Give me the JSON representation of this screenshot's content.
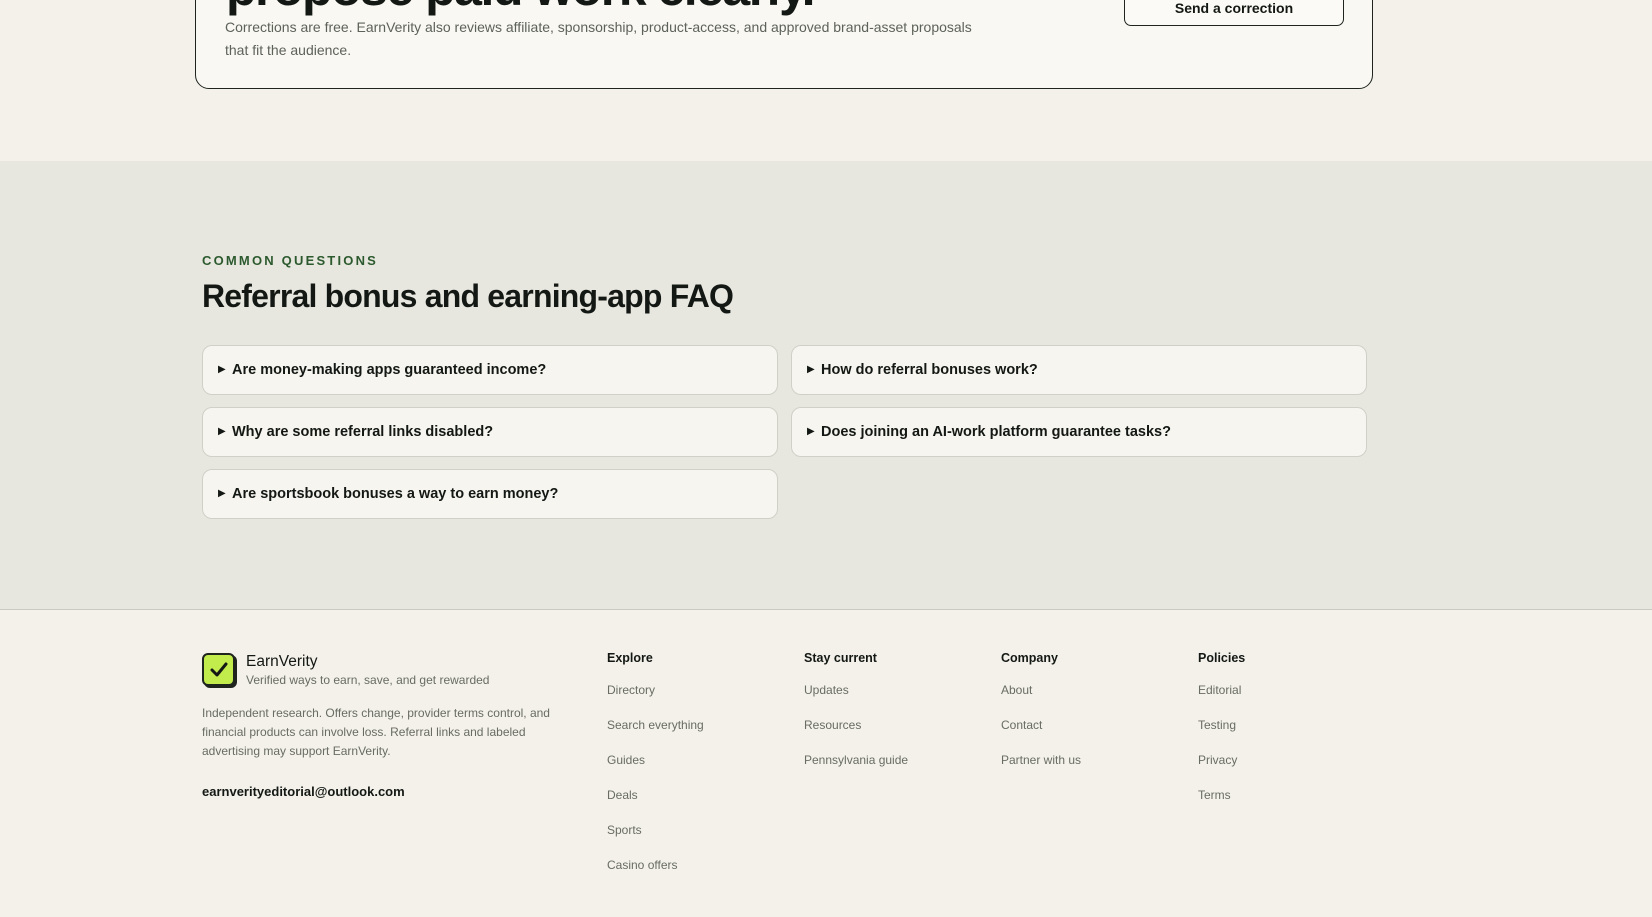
{
  "cta": {
    "heading": "propose paid work clearly.",
    "text": "Corrections are free. EarnVerity also reviews affiliate, sponsorship, product-access, and approved brand-asset proposals that fit the audience.",
    "button_label": "Send a correction"
  },
  "faq": {
    "eyebrow": "COMMON QUESTIONS",
    "title": "Referral bonus and earning-app FAQ",
    "items": [
      {
        "question": "Are money-making apps guaranteed income?"
      },
      {
        "question": "How do referral bonuses work?"
      },
      {
        "question": "Why are some referral links disabled?"
      },
      {
        "question": "Does joining an AI-work platform guarantee tasks?"
      },
      {
        "question": "Are sportsbook bonuses a way to earn money?"
      }
    ],
    "toggle_icon": "triangle-right-icon"
  },
  "footer": {
    "brand": {
      "name": "EarnVerity",
      "tagline": "Verified ways to earn, save, and get rewarded",
      "description": "Independent research. Offers change, provider terms control, and financial products can involve loss. Referral links and labeled advertising may support EarnVerity.",
      "email": "earnverityeditorial@outlook.com",
      "logo_icon": "checkmark-icon",
      "logo_color": "#c2eb4c"
    },
    "columns": [
      {
        "title": "Explore",
        "links": [
          "Directory",
          "Search everything",
          "Guides",
          "Deals",
          "Sports",
          "Casino offers"
        ]
      },
      {
        "title": "Stay current",
        "links": [
          "Updates",
          "Resources",
          "Pennsylvania guide"
        ]
      },
      {
        "title": "Company",
        "links": [
          "About",
          "Contact",
          "Partner with us"
        ]
      },
      {
        "title": "Policies",
        "links": [
          "Editorial",
          "Testing",
          "Privacy",
          "Terms"
        ]
      }
    ]
  }
}
